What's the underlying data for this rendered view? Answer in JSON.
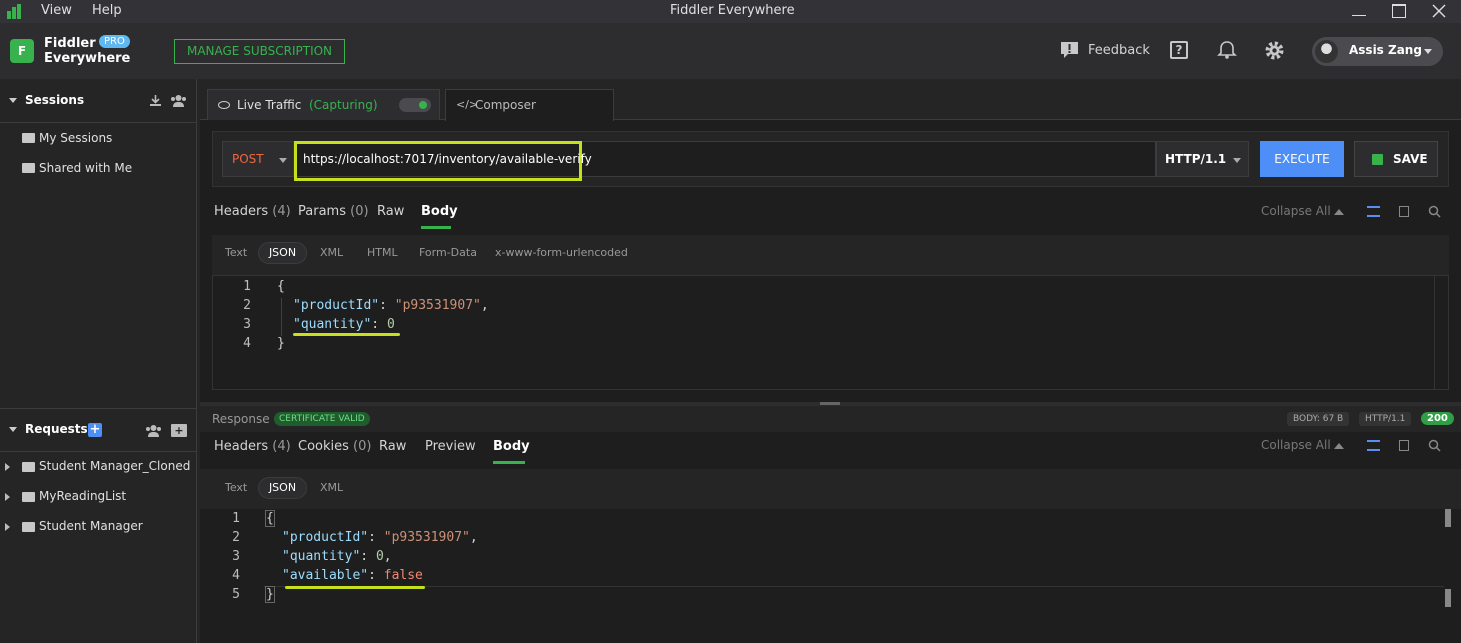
{
  "menubar": {
    "items": [
      "View",
      "Help"
    ],
    "title": "Fiddler Everywhere",
    "controls": [
      "minimize",
      "maximize",
      "close"
    ]
  },
  "header": {
    "logo_line1": "Fiddler",
    "logo_line2": "Everywhere",
    "pro_badge": "PRO",
    "manage_subscription": "MANAGE SUBSCRIPTION",
    "feedback": "Feedback",
    "user_name": "Assis Zang"
  },
  "sidebar": {
    "sessions_title": "Sessions",
    "sessions_items": [
      "My Sessions",
      "Shared with Me"
    ],
    "requests_title": "Requests",
    "requests_items": [
      "Student Manager_Cloned",
      "MyReadingList",
      "Student Manager"
    ]
  },
  "tabs": {
    "live_traffic": "Live Traffic",
    "capturing": "(Capturing)",
    "composer": "Composer"
  },
  "request": {
    "method": "POST",
    "url": "https://localhost:7017/inventory/available-verify",
    "http_version": "HTTP/1.1",
    "execute": "EXECUTE",
    "save": "SAVE",
    "tabs": [
      {
        "label": "Headers",
        "count": "(4)"
      },
      {
        "label": "Params",
        "count": "(0)"
      },
      {
        "label": "Raw",
        "count": ""
      },
      {
        "label": "Body",
        "count": ""
      }
    ],
    "collapse_all": "Collapse All",
    "body_types": [
      "Text",
      "JSON",
      "XML",
      "HTML",
      "Form-Data",
      "x-www-form-urlencoded"
    ],
    "line_numbers": [
      "1",
      "2",
      "3",
      "4"
    ],
    "code_lines": [
      "{",
      "\"productId\": \"p93531907\",",
      "\"quantity\": 0",
      "}"
    ]
  },
  "response": {
    "label": "Response",
    "cert_badge": "CERTIFICATE VALID",
    "body_size": "BODY: 67 B",
    "http_version": "HTTP/1.1",
    "status": "200",
    "tabs": [
      {
        "label": "Headers",
        "count": "(4)"
      },
      {
        "label": "Cookies",
        "count": "(0)"
      },
      {
        "label": "Raw",
        "count": ""
      },
      {
        "label": "Preview",
        "count": ""
      },
      {
        "label": "Body",
        "count": ""
      }
    ],
    "collapse_all": "Collapse All",
    "body_types": [
      "Text",
      "JSON",
      "XML"
    ],
    "line_numbers": [
      "1",
      "2",
      "3",
      "4",
      "5"
    ],
    "code_lines": [
      "{",
      "\"productId\": \"p93531907\",",
      "\"quantity\": 0,",
      "\"available\": false",
      "}"
    ]
  },
  "colors": {
    "accent_green": "#37b24d",
    "highlight": "#c6e01e",
    "execute_blue": "#4d8ef7",
    "method_orange": "#f0663f"
  }
}
